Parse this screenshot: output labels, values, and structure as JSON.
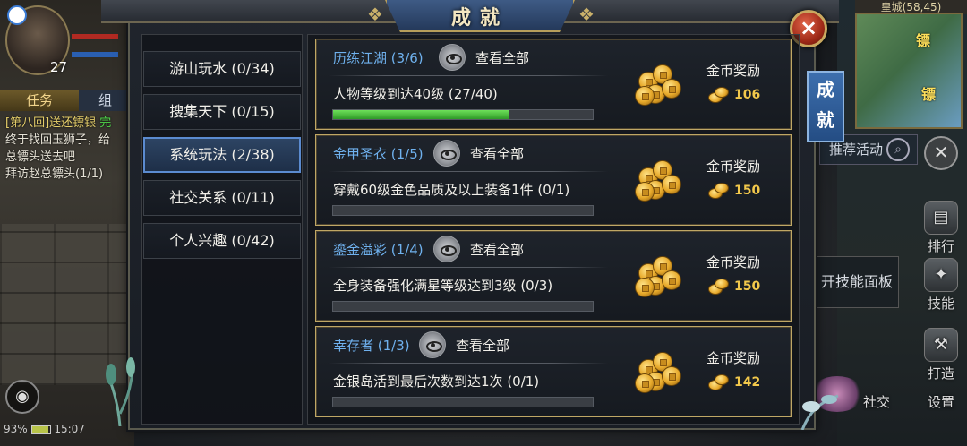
{
  "hud": {
    "level": "27",
    "tab_task": "任务",
    "tab_team": "组",
    "quest_log": [
      {
        "text": "[第八回]送还镖银",
        "status": "完"
      },
      {
        "text": "终于找回玉狮子，给"
      },
      {
        "text": "总镖头送去吧"
      },
      {
        "text": "拜访赵总镖头(1/1)"
      }
    ],
    "status": {
      "battery": "93%",
      "time": "15:07"
    },
    "minimap_location": "皇城(58,45)",
    "minimap_markers": [
      "镖",
      "镖"
    ],
    "promo_button": "推荐活动",
    "side_buttons": [
      {
        "label": "排行",
        "icon": "ranking-icon"
      },
      {
        "label": "技能",
        "icon": "skill-icon"
      },
      {
        "label": "打造",
        "icon": "forge-icon"
      },
      {
        "label": "社交",
        "icon": "social-icon"
      },
      {
        "label": "设置",
        "icon": "settings-icon"
      }
    ],
    "skill_panel_button": "开技能面板"
  },
  "dialog": {
    "title": "成就",
    "side_tab": "成就",
    "close_label": "×"
  },
  "categories": [
    {
      "label": "游山玩水 (0/34)",
      "active": false
    },
    {
      "label": "搜集天下 (0/15)",
      "active": false
    },
    {
      "label": "系统玩法 (2/38)",
      "active": true
    },
    {
      "label": "社交关系 (0/11)",
      "active": false
    },
    {
      "label": "个人兴趣 (0/42)",
      "active": false
    }
  ],
  "achievements": [
    {
      "title": "历练江湖 (3/6)",
      "view_all": "查看全部",
      "desc": "人物等级到达40级 (27/40)",
      "progress": 0.675,
      "reward_label": "金币奖励",
      "reward_value": "106"
    },
    {
      "title": "金甲圣衣 (1/5)",
      "view_all": "查看全部",
      "desc": "穿戴60级金色品质及以上装备1件 (0/1)",
      "progress": 0,
      "reward_label": "金币奖励",
      "reward_value": "150"
    },
    {
      "title": "鎏金溢彩 (1/4)",
      "view_all": "查看全部",
      "desc": "全身装备强化满星等级达到3级 (0/3)",
      "progress": 0,
      "reward_label": "金币奖励",
      "reward_value": "150"
    },
    {
      "title": "幸存者 (1/3)",
      "view_all": "查看全部",
      "desc": "金银岛活到最后次数到达1次 (0/1)",
      "progress": 0,
      "reward_label": "金币奖励",
      "reward_value": "142"
    }
  ],
  "colors": {
    "accent_blue": "#5b8bd0",
    "title_blue": "#6fb1ee",
    "gold": "#f2c84b",
    "progress_green": "#4fc23a",
    "card_border": "#bfa765"
  }
}
